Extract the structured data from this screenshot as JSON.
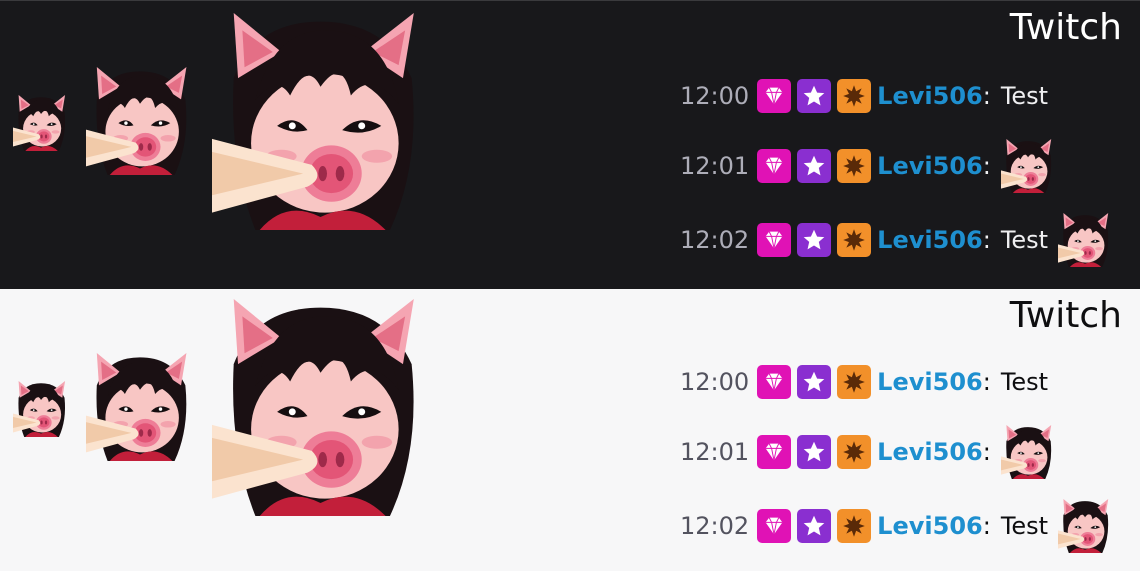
{
  "colors": {
    "dark_bg": "#18181b",
    "light_bg": "#f7f7f8",
    "username": "#1e8fcf",
    "badge_pink": "#e012b5",
    "badge_purple": "#8a2fd0",
    "badge_orange": "#f2902a"
  },
  "icons": {
    "badge_1": "gem-icon",
    "badge_2": "star-icon",
    "badge_3": "starburst-icon",
    "emote": "pig-girl-emote"
  },
  "panels": [
    {
      "theme": "dark",
      "title": "Twitch",
      "messages": [
        {
          "time": "12:00",
          "user": "Levi506",
          "colon": ":",
          "text": "Test",
          "emote": false
        },
        {
          "time": "12:01",
          "user": "Levi506",
          "colon": ":",
          "text": "",
          "emote": true
        },
        {
          "time": "12:02",
          "user": "Levi506",
          "colon": ":",
          "text": "Test",
          "emote": true
        }
      ]
    },
    {
      "theme": "light",
      "title": "Twitch",
      "messages": [
        {
          "time": "12:00",
          "user": "Levi506",
          "colon": ":",
          "text": "Test",
          "emote": false
        },
        {
          "time": "12:01",
          "user": "Levi506",
          "colon": ":",
          "text": "",
          "emote": true
        },
        {
          "time": "12:02",
          "user": "Levi506",
          "colon": ":",
          "text": "Test",
          "emote": true
        }
      ]
    }
  ]
}
